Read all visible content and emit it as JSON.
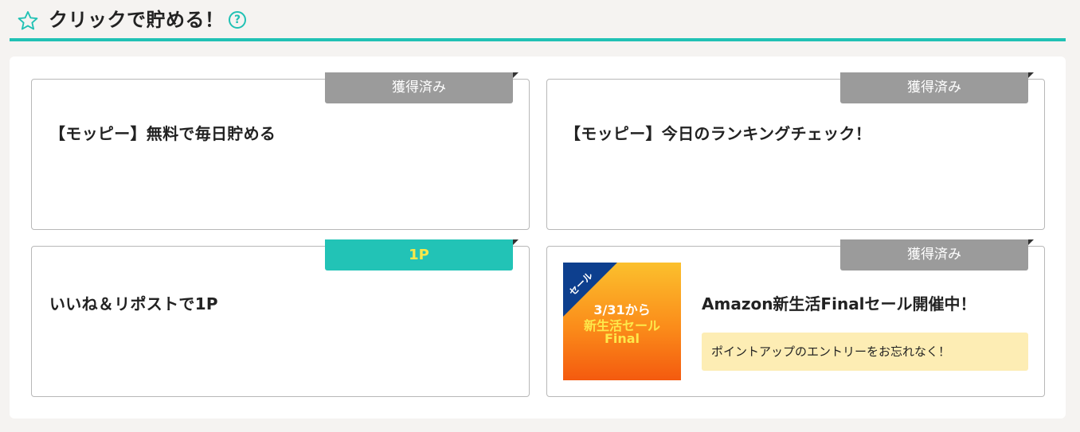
{
  "header": {
    "title": "クリックで貯める！",
    "help": "?"
  },
  "cards": [
    {
      "badge": "獲得済み",
      "title": "【モッピー】無料で毎日貯める"
    },
    {
      "badge": "獲得済み",
      "title": "【モッピー】今日のランキングチェック！"
    },
    {
      "badge": "1P",
      "title": "いいね＆リポストで1P"
    },
    {
      "badge": "獲得済み",
      "title": "Amazon新生活Finalセール開催中！",
      "note": "ポイントアップのエントリーをお忘れなく！",
      "thumb": {
        "corner": "セール",
        "line1": "3/31から",
        "line2": "新生活セール",
        "line3": "Final"
      }
    }
  ],
  "colors": {
    "accent": "#20c1b4",
    "badge_done": "#9b9b9b",
    "badge_points": "#22c3b6",
    "note_bg": "#fdedb4"
  },
  "icons": {
    "star": "star-outline-icon",
    "help": "question-circle-icon"
  }
}
